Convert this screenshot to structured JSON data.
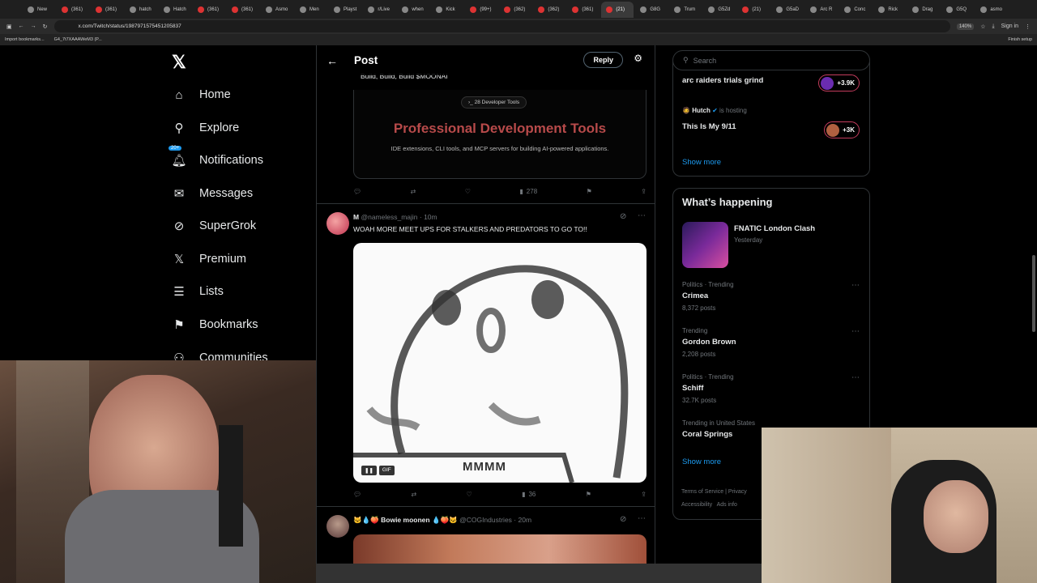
{
  "browser": {
    "tabs": [
      "New",
      "(361)",
      "(361)",
      "hatch",
      "Hatch",
      "(361)",
      "(361)",
      "Asmo",
      "Men",
      "Playst",
      "r/Live",
      "when",
      "Kick",
      "(99+)",
      "(362)",
      "(362)",
      "(361)",
      "(21)",
      "G8G",
      "Trum",
      "G5Zd",
      "(21)",
      "G5aD",
      "Arc R",
      "Conc",
      "Rick",
      "Drag",
      "G5Q",
      "asmo"
    ],
    "url": "x.com/Twitch/status/1987971575451205837",
    "zoom": "140%",
    "sign_in": "Sign in",
    "finish_setup": "Finish setup",
    "bookmarks": [
      "Import bookmarks...",
      "G4_7t7XAAAWeM3 (P..."
    ]
  },
  "nav": {
    "items": [
      {
        "label": "Home",
        "icon": "home-icon"
      },
      {
        "label": "Explore",
        "icon": "search-icon"
      },
      {
        "label": "Notifications",
        "icon": "bell-icon",
        "badge": "20+"
      },
      {
        "label": "Messages",
        "icon": "mail-icon"
      },
      {
        "label": "SuperGrok",
        "icon": "grok-icon"
      },
      {
        "label": "Premium",
        "icon": "x-icon"
      },
      {
        "label": "Lists",
        "icon": "list-icon"
      },
      {
        "label": "Bookmarks",
        "icon": "bookmark-icon"
      },
      {
        "label": "Communities",
        "icon": "people-icon"
      }
    ]
  },
  "post": {
    "header_title": "Post",
    "reply_label": "Reply",
    "quote_text": "Build, Build, Build $MOONAI",
    "dev_pill": "28 Developer Tools",
    "dev_title": "Professional Development Tools",
    "dev_sub": "IDE extensions, CLI tools, and MCP servers for building AI-powered applications.",
    "views1": "278",
    "tweet2": {
      "name": "M",
      "handle": "@nameless_majin",
      "time": "· 10m",
      "text": "WOAH MORE MEET UPS FOR STALKERS AND PREDATORS TO GO TO!!",
      "gif_caption": "MMMM",
      "gif_label": "GIF",
      "views": "36"
    },
    "tweet3": {
      "name": "Bowie moonen",
      "handle": "@COGIndustries",
      "time": "· 20m"
    }
  },
  "right": {
    "search_placeholder": "Search",
    "live": [
      {
        "title": "arc raiders trials grind",
        "count": "+3.9K"
      },
      {
        "host": "Hutch",
        "hosting": "is hosting",
        "title": "This Is My 9/11",
        "count": "+3K"
      }
    ],
    "show_more": "Show more",
    "happening_title": "What’s happening",
    "event": {
      "title": "FNATIC London Clash",
      "time": "Yesterday"
    },
    "trends": [
      {
        "category": "Politics · Trending",
        "name": "Crimea",
        "posts": "8,372 posts"
      },
      {
        "category": "Trending",
        "name": "Gordon Brown",
        "posts": "2,208 posts"
      },
      {
        "category": "Politics · Trending",
        "name": "Schiff",
        "posts": "32.7K posts"
      },
      {
        "category": "Trending in United States",
        "name": "Coral Springs",
        "posts": ""
      }
    ],
    "show_more2": "Show more",
    "footer": [
      "Terms of Service",
      "Privacy",
      "Accessibility",
      "Ads info"
    ]
  },
  "colors": {
    "accent": "#1d9bf0",
    "live": "#c43c5d",
    "devtitle": "#b74a4a"
  }
}
